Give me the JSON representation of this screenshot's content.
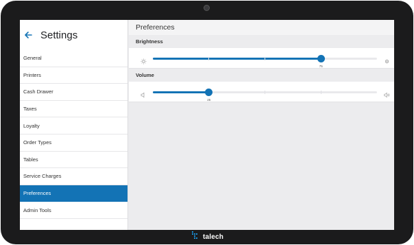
{
  "sidebar": {
    "title": "Settings",
    "items": [
      {
        "label": "General",
        "active": false
      },
      {
        "label": "Printers",
        "active": false
      },
      {
        "label": "Cash Drawer",
        "active": false
      },
      {
        "label": "Taxes",
        "active": false
      },
      {
        "label": "Loyalty",
        "active": false
      },
      {
        "label": "Order Types",
        "active": false
      },
      {
        "label": "Tables",
        "active": false
      },
      {
        "label": "Service Charges",
        "active": false
      },
      {
        "label": "Preferences",
        "active": true
      },
      {
        "label": "Admin Tools",
        "active": false
      }
    ]
  },
  "main": {
    "title": "Preferences",
    "brightness": {
      "label": "Brightness",
      "value": 75,
      "value_label": "75",
      "min_icon": "brightness-low-icon",
      "max_icon": "brightness-high-icon"
    },
    "volume": {
      "label": "Volume",
      "value": 25,
      "value_label": "25",
      "min_icon": "volume-low-icon",
      "max_icon": "volume-high-icon"
    }
  },
  "device": {
    "brand": "talech"
  },
  "colors": {
    "accent": "#1373b5",
    "bezel": "#1b1b1c",
    "background": "#ececee"
  }
}
